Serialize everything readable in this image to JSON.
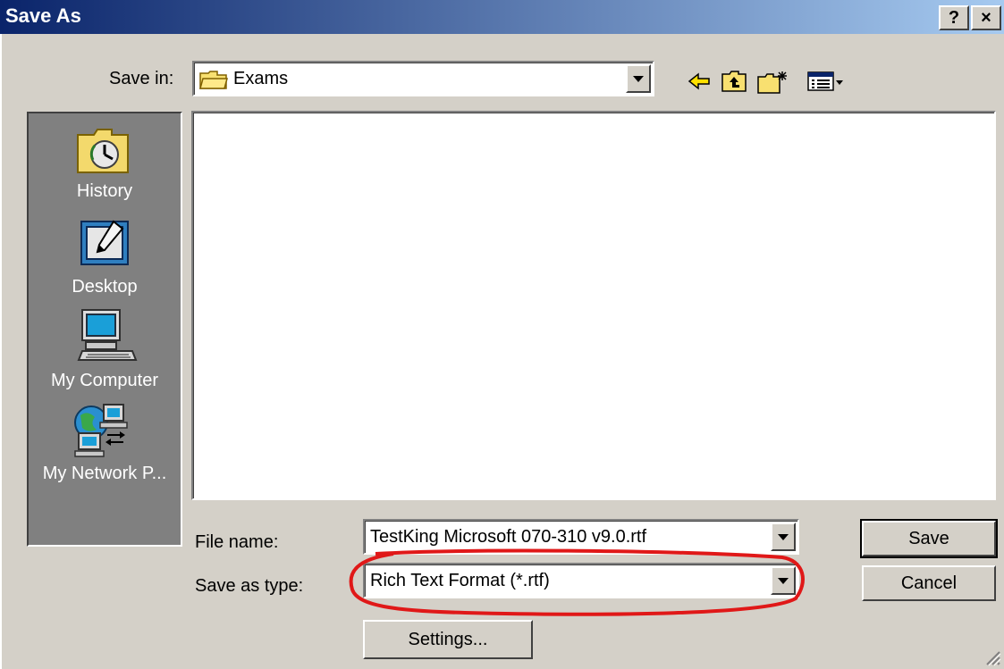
{
  "window": {
    "title": "Save As",
    "help_btn": "?",
    "close_btn": "×"
  },
  "save_in": {
    "label": "Save in:",
    "value": "Exams",
    "folder_icon": "folder-icon"
  },
  "toolbar": {
    "back_icon": "back-arrow-icon",
    "up_icon": "up-folder-icon",
    "new_folder_icon": "new-folder-icon",
    "views_icon": "views-menu-icon"
  },
  "places": [
    {
      "label": "History",
      "icon": "history-icon"
    },
    {
      "label": "Desktop",
      "icon": "desktop-icon"
    },
    {
      "label": "My Computer",
      "icon": "my-computer-icon"
    },
    {
      "label": "My Network P...",
      "icon": "my-network-places-icon"
    }
  ],
  "file_name": {
    "label": "File name:",
    "value": "TestKing Microsoft 070-310 v9.0.rtf"
  },
  "save_as_type": {
    "label": "Save as type:",
    "value": "Rich Text Format (*.rtf)"
  },
  "buttons": {
    "save": "Save",
    "cancel": "Cancel",
    "settings": "Settings..."
  },
  "colors": {
    "title_start": "#0a246a",
    "title_end": "#a6caf0",
    "face": "#d4d0c8",
    "places_bg": "#808080",
    "annotation": "#e01818"
  }
}
